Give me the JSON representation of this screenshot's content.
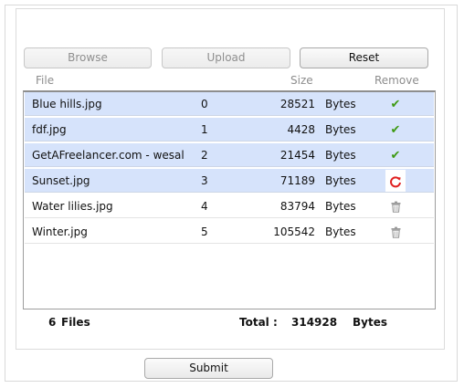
{
  "toolbar": {
    "browse_label": "Browse",
    "upload_label": "Upload",
    "reset_label": "Reset"
  },
  "columns": {
    "file": "File",
    "size": "Size",
    "remove": "Remove"
  },
  "files": [
    {
      "name": "Blue hills.jpg",
      "index": "0",
      "size": "28521",
      "unit": "Bytes",
      "status": "uploaded"
    },
    {
      "name": "fdf.jpg",
      "index": "1",
      "size": "4428",
      "unit": "Bytes",
      "status": "uploaded"
    },
    {
      "name": "GetAFreelancer.com - wesal",
      "index": "2",
      "size": "21454",
      "unit": "Bytes",
      "status": "uploaded"
    },
    {
      "name": "Sunset.jpg",
      "index": "3",
      "size": "71189",
      "unit": "Bytes",
      "status": "uploading"
    },
    {
      "name": "Water lilies.jpg",
      "index": "4",
      "size": "83794",
      "unit": "Bytes",
      "status": "pending"
    },
    {
      "name": "Winter.jpg",
      "index": "5",
      "size": "105542",
      "unit": "Bytes",
      "status": "pending"
    }
  ],
  "summary": {
    "count": "6",
    "files_label": "Files",
    "total_label": "Total :",
    "total_value": "314928",
    "total_unit": "Bytes"
  },
  "submit_label": "Submit",
  "icons": {
    "uploaded": "check-icon",
    "uploading": "refresh-icon",
    "pending": "trash-icon"
  },
  "colors": {
    "selected_row": "#d6e3fb",
    "check": "#3e9a13",
    "refresh": "#e02020"
  }
}
